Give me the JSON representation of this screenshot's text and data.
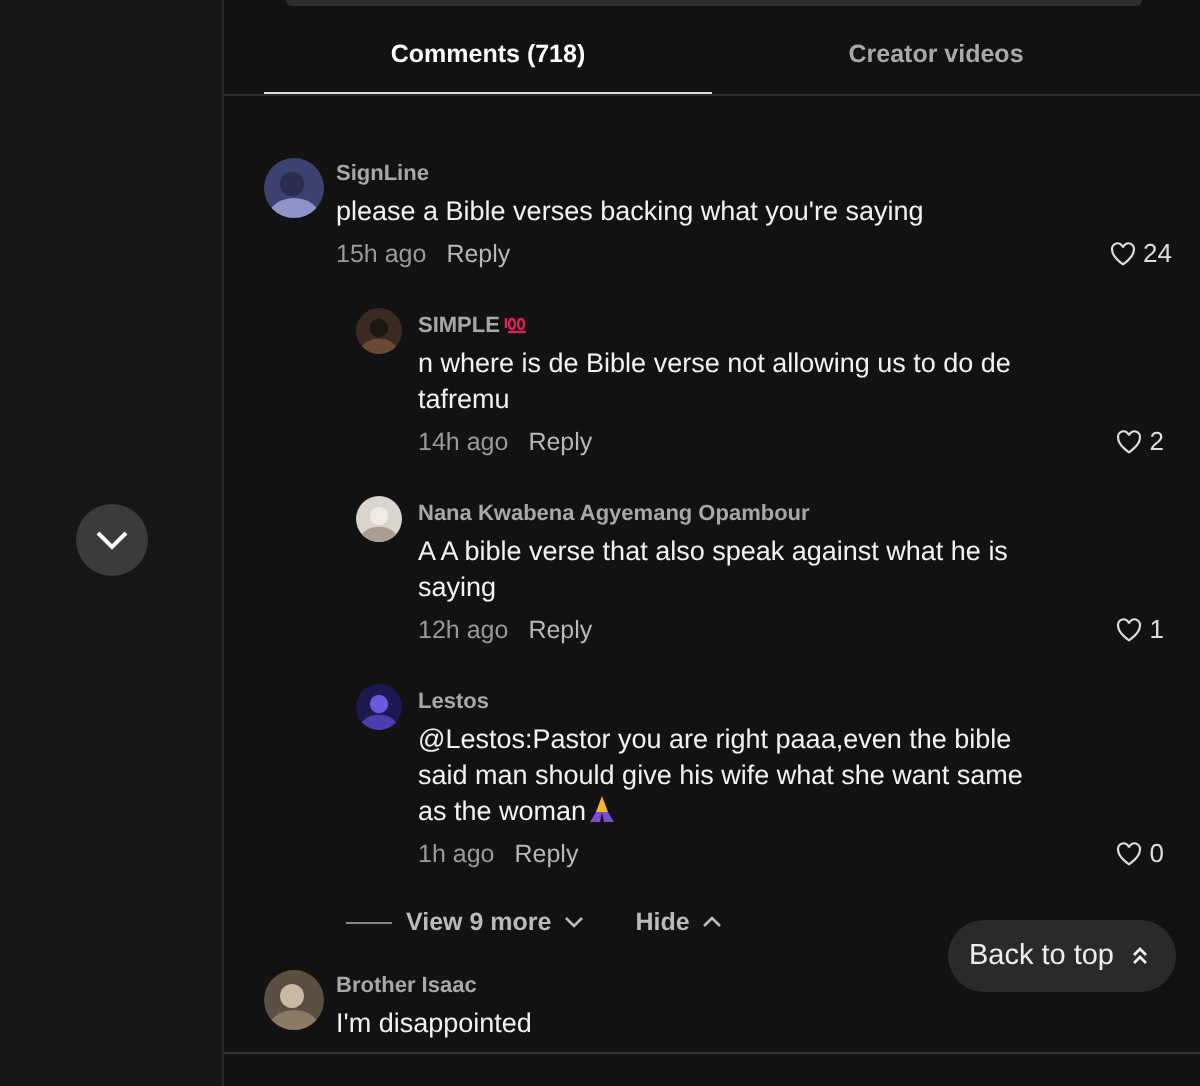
{
  "tabs": [
    {
      "label": "Comments (718)",
      "selected": true
    },
    {
      "label": "Creator videos",
      "selected": false
    }
  ],
  "comments": [
    {
      "author": "SignLine",
      "text": "please a Bible verses backing what you're saying",
      "time": "15h ago",
      "reply": "Reply",
      "likes": "24",
      "replies": [
        {
          "author": "SIMPLE",
          "author_badge": true,
          "text": "n where is de Bible verse not allowing us to do de tafremu",
          "time": "14h ago",
          "reply": "Reply",
          "likes": "2"
        },
        {
          "author": "Nana Kwabena Agyemang Opambour",
          "text": "A A bible verse that also speak against what he is saying",
          "time": "12h ago",
          "reply": "Reply",
          "likes": "1"
        },
        {
          "author": "Lestos",
          "text": "@Lestos:Pastor you are right paaa,even the bible said man should give his wife what she want same as the woman",
          "text_icon": true,
          "time": "1h ago",
          "reply": "Reply",
          "likes": "0"
        }
      ],
      "thread": {
        "view_more": "View 9 more",
        "hide": "Hide"
      }
    },
    {
      "author": "Brother Isaac",
      "text": "I'm disappointed"
    }
  ],
  "back_to_top": "Back to top"
}
